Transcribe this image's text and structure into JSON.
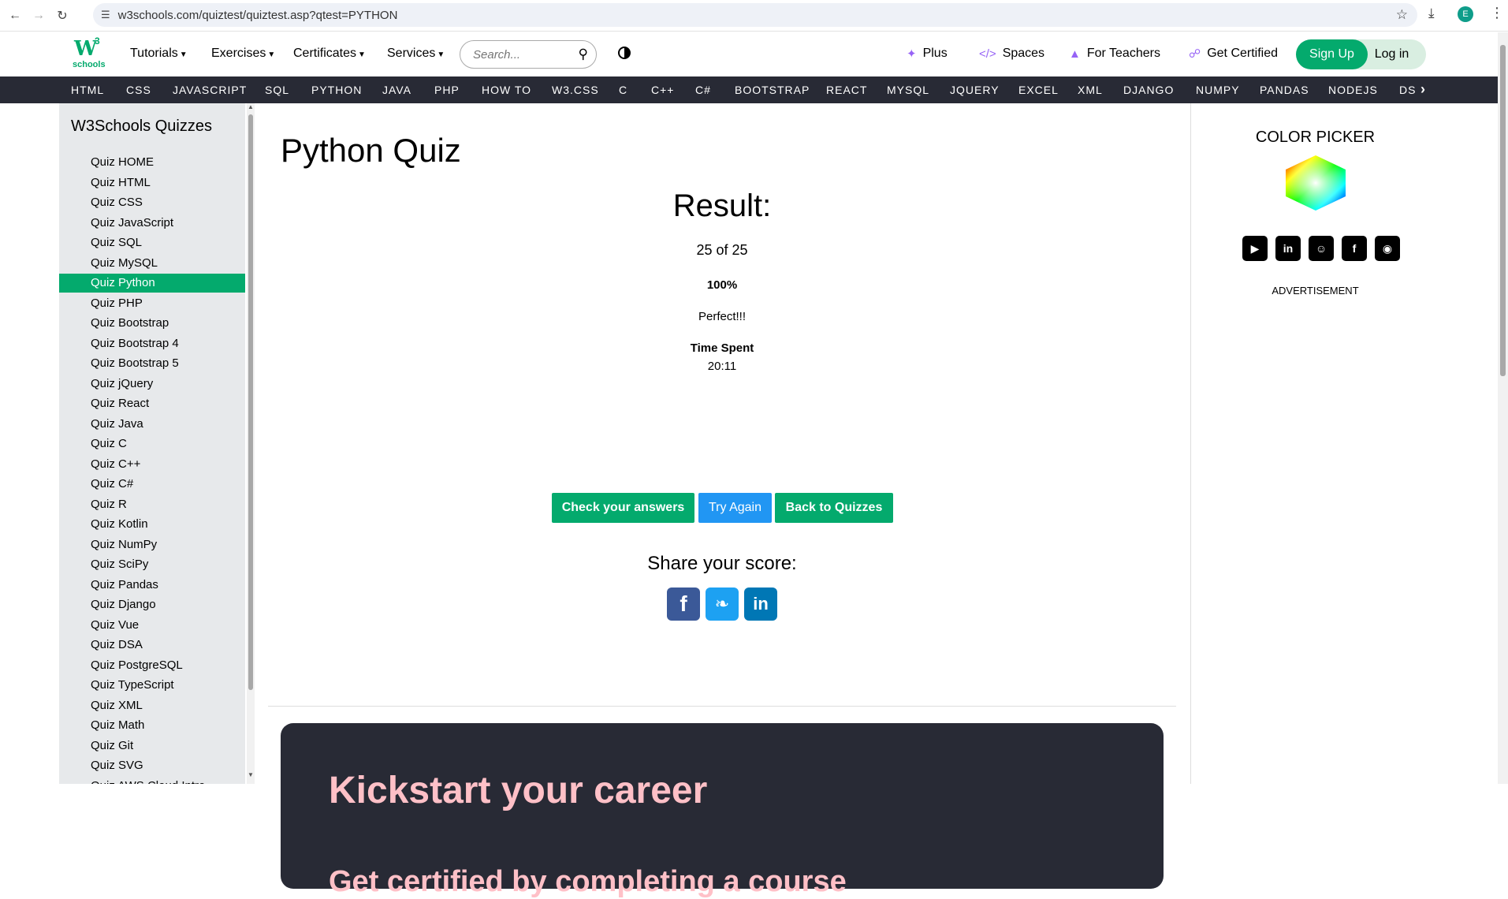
{
  "browser": {
    "url": "w3schools.com/quiztest/quiztest.asp?qtest=PYTHON",
    "profile_initial": "E"
  },
  "topnav": {
    "logo_w": "W",
    "logo_3": "3",
    "logo_schools": "schools",
    "tutorials": "Tutorials",
    "exercises": "Exercises",
    "certificates": "Certificates",
    "services": "Services",
    "search_placeholder": "Search...",
    "plus": "Plus",
    "spaces": "Spaces",
    "for_teachers": "For Teachers",
    "get_certified": "Get Certified",
    "sign_up": "Sign Up",
    "log_in": "Log in"
  },
  "subnav": [
    "HTML",
    "CSS",
    "JAVASCRIPT",
    "SQL",
    "PYTHON",
    "JAVA",
    "PHP",
    "HOW TO",
    "W3.CSS",
    "C",
    "C++",
    "C#",
    "BOOTSTRAP",
    "REACT",
    "MYSQL",
    "JQUERY",
    "EXCEL",
    "XML",
    "DJANGO",
    "NUMPY",
    "PANDAS",
    "NODEJS",
    "DS"
  ],
  "sidebar": {
    "title": "W3Schools Quizzes",
    "items": [
      "Quiz HOME",
      "Quiz HTML",
      "Quiz CSS",
      "Quiz JavaScript",
      "Quiz SQL",
      "Quiz MySQL",
      "Quiz Python",
      "Quiz PHP",
      "Quiz Bootstrap",
      "Quiz Bootstrap 4",
      "Quiz Bootstrap 5",
      "Quiz jQuery",
      "Quiz React",
      "Quiz Java",
      "Quiz C",
      "Quiz C++",
      "Quiz C#",
      "Quiz R",
      "Quiz Kotlin",
      "Quiz NumPy",
      "Quiz SciPy",
      "Quiz Pandas",
      "Quiz Django",
      "Quiz Vue",
      "Quiz DSA",
      "Quiz PostgreSQL",
      "Quiz TypeScript",
      "Quiz XML",
      "Quiz Math",
      "Quiz Git",
      "Quiz SVG",
      "Quiz AWS Cloud Intro"
    ],
    "active": "Quiz Python"
  },
  "main": {
    "page_title": "Python Quiz",
    "result_title": "Result:",
    "score": "25 of 25",
    "percent": "100%",
    "verdict": "Perfect!!!",
    "time_label": "Time Spent",
    "time_value": "20:11",
    "check_answers": "Check your answers",
    "try_again": "Try Again",
    "back_to_quizzes": "Back to Quizzes",
    "share_title": "Share your score:",
    "career_title": "Kickstart your career",
    "career_subtitle": "Get certified by completing a course"
  },
  "right": {
    "color_picker": "COLOR PICKER",
    "advertisement": "ADVERTISEMENT"
  },
  "colors": {
    "green": "#04aa6d",
    "blue": "#2196f3",
    "dark": "#282a35",
    "pink": "#ffc0c7"
  }
}
